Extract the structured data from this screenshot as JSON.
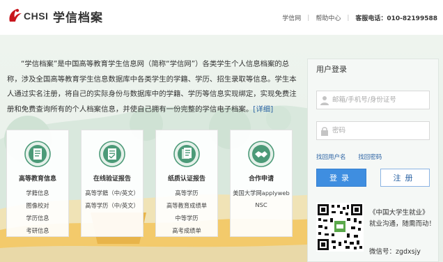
{
  "header": {
    "logo_text": "CHSI",
    "site_title": "学信档案",
    "nav": {
      "home": "学信网",
      "help": "帮助中心",
      "phone": "客服电话：010-82199588"
    }
  },
  "intro": {
    "text": "“学信档案”是中国高等教育学生信息网（简称“学信网”）各类学生个人信息档案的总称，涉及全国高等教育学生信息数据库中各类学生的学籍、学历、招生录取等信息。学生本人通过实名注册，将自己的实际身份与数据库中的学籍、学历等信息实现绑定，实现免费注册和免费查询所有的个人档案信息，并使自己拥有一份完整的学信电子档案。",
    "more": "[详细]"
  },
  "cards": [
    {
      "title": "高等教育信息",
      "links": [
        "学籍信息",
        "图像校对",
        "学历信息",
        "考研信息"
      ],
      "icon": "document-icon"
    },
    {
      "title": "在线验证报告",
      "links": [
        "高等学籍（中/英文）",
        "高等学历（中/英文）"
      ],
      "icon": "verify-report-icon"
    },
    {
      "title": "纸质认证报告",
      "links": [
        "高等学历",
        "高等教育成绩单",
        "中等学历",
        "高考成绩单"
      ],
      "icon": "paper-report-icon"
    },
    {
      "title": "合作申请",
      "links": [
        "美国大学网applyweb",
        "NSC"
      ],
      "icon": "handshake-icon"
    }
  ],
  "login": {
    "title": "用户登录",
    "username_placeholder": "邮箱/手机号/身份证号",
    "password_placeholder": "密码",
    "forgot_username": "找回用户名",
    "forgot_password": "找回密码",
    "login_button": "登录",
    "register_button": "注册",
    "promo_line1": "《中国大学生就业》",
    "promo_line2": "就业沟通，随需而动！",
    "wechat": "微信号：zgdxsjy"
  },
  "colors": {
    "accent": "#3f8ee0",
    "link": "#2a62a3",
    "icon_green": "#4c9a78"
  }
}
